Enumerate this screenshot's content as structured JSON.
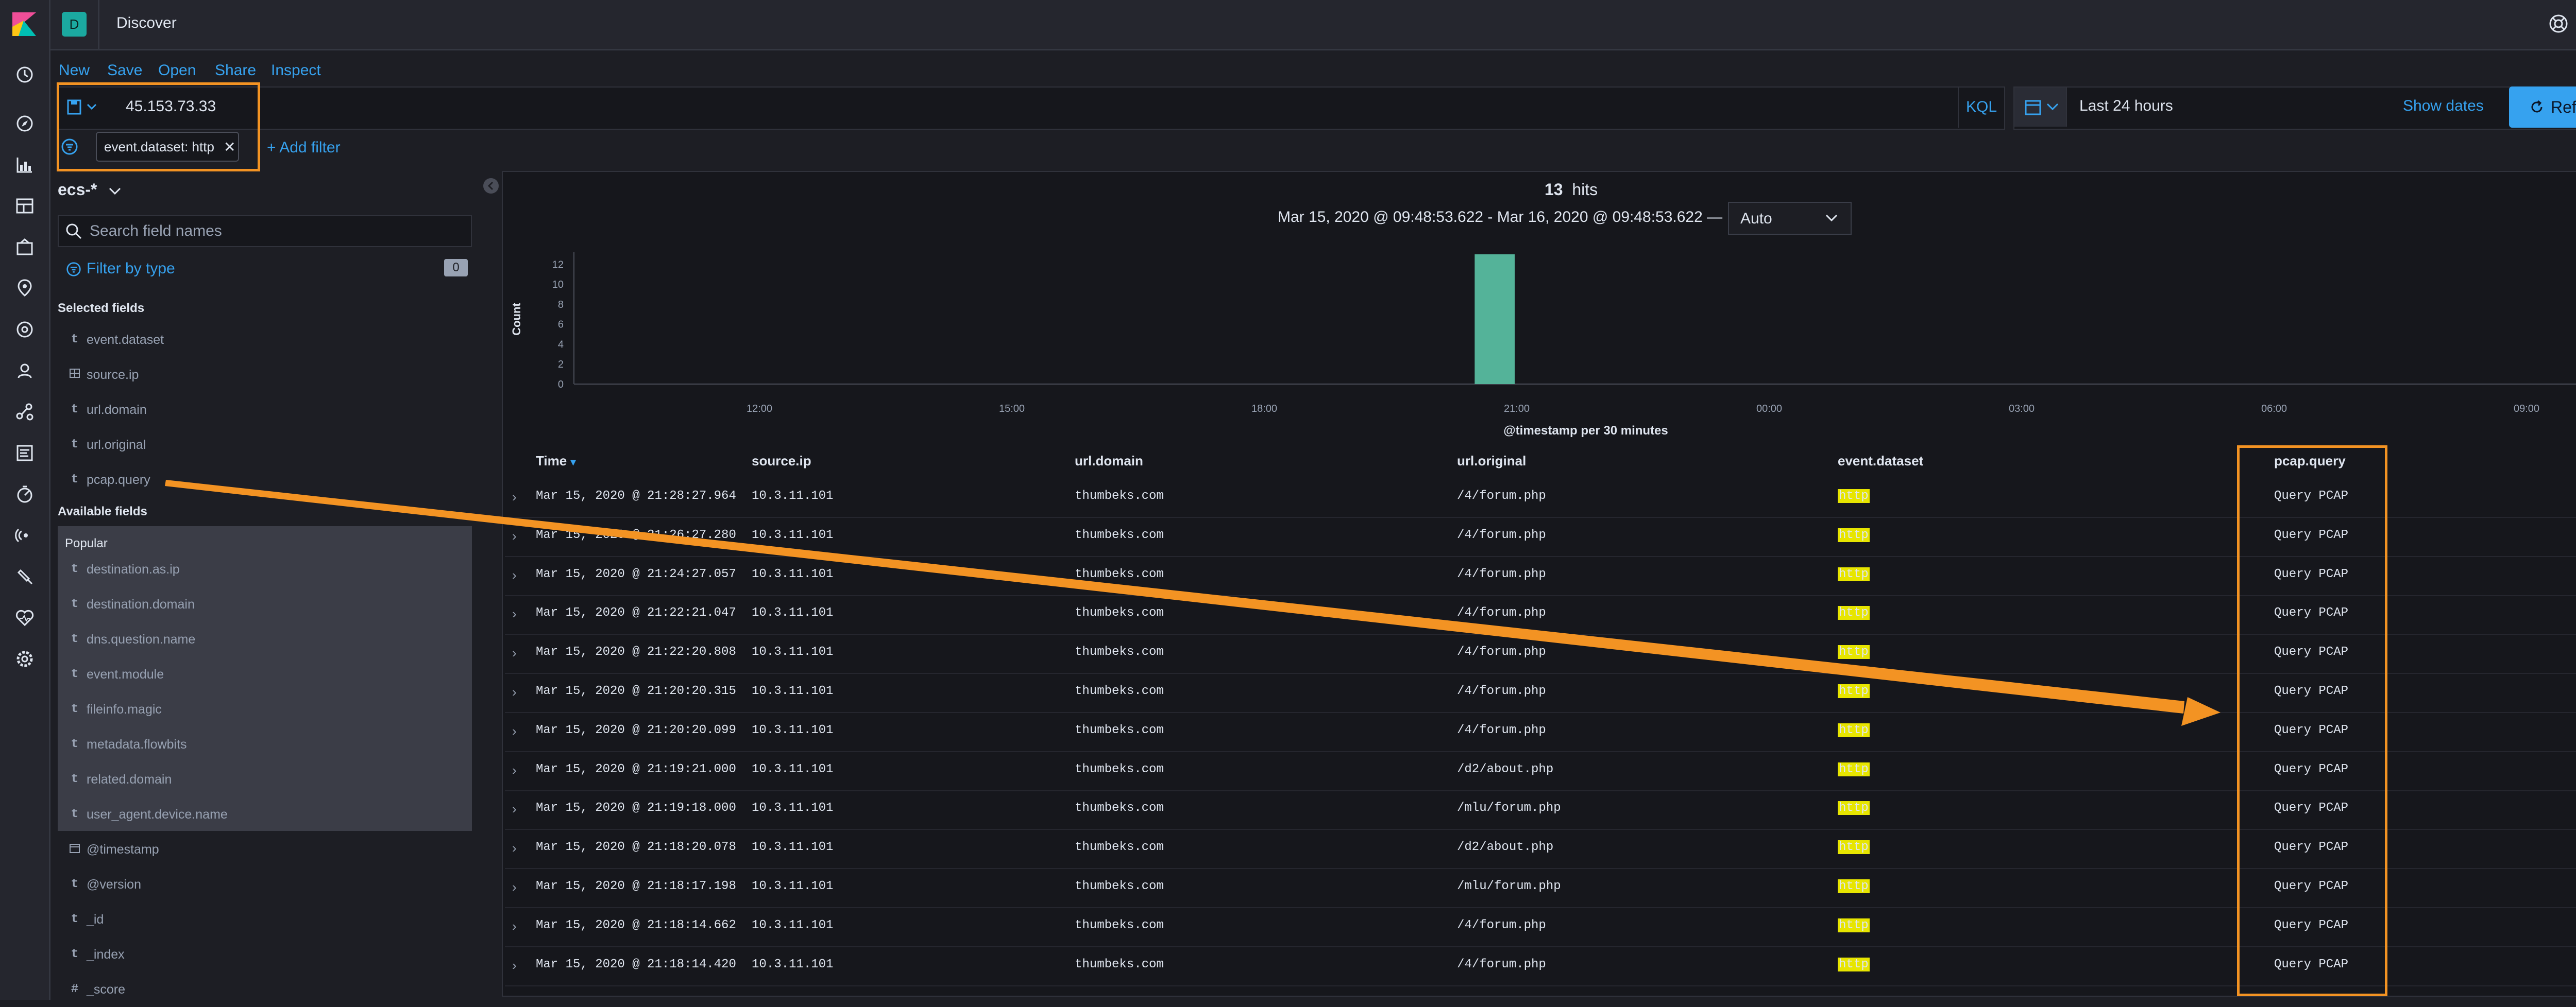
{
  "header": {
    "space_letter": "D",
    "app_title": "Discover"
  },
  "topmenu": [
    "New",
    "Save",
    "Open",
    "Share",
    "Inspect"
  ],
  "search": {
    "query": "45.153.73.33",
    "language": "KQL",
    "date_range": "Last 24 hours",
    "show_dates": "Show dates",
    "refresh": "Refresh"
  },
  "filters": {
    "pill": "event.dataset: http",
    "add_filter": "+ Add filter"
  },
  "sidebar": {
    "index_pattern": "ecs-*",
    "search_placeholder": "Search field names",
    "filter_by_type": "Filter by type",
    "filter_count": "0",
    "selected_title": "Selected fields",
    "selected": [
      {
        "type": "t",
        "name": "event.dataset"
      },
      {
        "type": "ip",
        "name": "source.ip"
      },
      {
        "type": "t",
        "name": "url.domain"
      },
      {
        "type": "t",
        "name": "url.original"
      },
      {
        "type": "t",
        "name": "pcap.query"
      }
    ],
    "available_title": "Available fields",
    "popular_title": "Popular",
    "popular": [
      {
        "type": "t",
        "name": "destination.as.ip"
      },
      {
        "type": "t",
        "name": "destination.domain"
      },
      {
        "type": "t",
        "name": "dns.question.name"
      },
      {
        "type": "t",
        "name": "event.module"
      },
      {
        "type": "t",
        "name": "fileinfo.magic"
      },
      {
        "type": "t",
        "name": "metadata.flowbits"
      },
      {
        "type": "t",
        "name": "related.domain"
      },
      {
        "type": "t",
        "name": "user_agent.device.name"
      }
    ],
    "other": [
      {
        "type": "date",
        "name": "@timestamp"
      },
      {
        "type": "t",
        "name": "@version"
      },
      {
        "type": "t",
        "name": "_id"
      },
      {
        "type": "t",
        "name": "_index"
      },
      {
        "type": "#",
        "name": "_score"
      }
    ]
  },
  "hits": {
    "count": "13",
    "label": "hits"
  },
  "date_range_text": "Mar 15, 2020 @ 09:48:53.622 - Mar 16, 2020 @ 09:48:53.622 —",
  "interval": "Auto",
  "chart_data": {
    "type": "bar",
    "ylabel": "Count",
    "xlabel": "@timestamp per 30 minutes",
    "yticks": [
      "0",
      "2",
      "4",
      "6",
      "8",
      "10",
      "12"
    ],
    "ylim": [
      0,
      13
    ],
    "xticks": [
      "12:00",
      "15:00",
      "18:00",
      "21:00",
      "00:00",
      "03:00",
      "06:00",
      "09:00"
    ],
    "bars": [
      {
        "x": "20:30",
        "value": 13
      }
    ],
    "bar_color": "#54b399",
    "marker_color": "#d0454e"
  },
  "table": {
    "headers": [
      "Time",
      "source.ip",
      "url.domain",
      "url.original",
      "event.dataset",
      "pcap.query"
    ],
    "rows": [
      {
        "time": "Mar 15, 2020 @ 21:28:27.964",
        "ip": "10.3.11.101",
        "domain": "thumbeks.com",
        "url": "/4/forum.php",
        "dataset": "http",
        "pcap": "Query PCAP"
      },
      {
        "time": "Mar 15, 2020 @ 21:26:27.280",
        "ip": "10.3.11.101",
        "domain": "thumbeks.com",
        "url": "/4/forum.php",
        "dataset": "http",
        "pcap": "Query PCAP"
      },
      {
        "time": "Mar 15, 2020 @ 21:24:27.057",
        "ip": "10.3.11.101",
        "domain": "thumbeks.com",
        "url": "/4/forum.php",
        "dataset": "http",
        "pcap": "Query PCAP"
      },
      {
        "time": "Mar 15, 2020 @ 21:22:21.047",
        "ip": "10.3.11.101",
        "domain": "thumbeks.com",
        "url": "/4/forum.php",
        "dataset": "http",
        "pcap": "Query PCAP"
      },
      {
        "time": "Mar 15, 2020 @ 21:22:20.808",
        "ip": "10.3.11.101",
        "domain": "thumbeks.com",
        "url": "/4/forum.php",
        "dataset": "http",
        "pcap": "Query PCAP"
      },
      {
        "time": "Mar 15, 2020 @ 21:20:20.315",
        "ip": "10.3.11.101",
        "domain": "thumbeks.com",
        "url": "/4/forum.php",
        "dataset": "http",
        "pcap": "Query PCAP"
      },
      {
        "time": "Mar 15, 2020 @ 21:20:20.099",
        "ip": "10.3.11.101",
        "domain": "thumbeks.com",
        "url": "/4/forum.php",
        "dataset": "http",
        "pcap": "Query PCAP"
      },
      {
        "time": "Mar 15, 2020 @ 21:19:21.000",
        "ip": "10.3.11.101",
        "domain": "thumbeks.com",
        "url": "/d2/about.php",
        "dataset": "http",
        "pcap": "Query PCAP"
      },
      {
        "time": "Mar 15, 2020 @ 21:19:18.000",
        "ip": "10.3.11.101",
        "domain": "thumbeks.com",
        "url": "/mlu/forum.php",
        "dataset": "http",
        "pcap": "Query PCAP"
      },
      {
        "time": "Mar 15, 2020 @ 21:18:20.078",
        "ip": "10.3.11.101",
        "domain": "thumbeks.com",
        "url": "/d2/about.php",
        "dataset": "http",
        "pcap": "Query PCAP"
      },
      {
        "time": "Mar 15, 2020 @ 21:18:17.198",
        "ip": "10.3.11.101",
        "domain": "thumbeks.com",
        "url": "/mlu/forum.php",
        "dataset": "http",
        "pcap": "Query PCAP"
      },
      {
        "time": "Mar 15, 2020 @ 21:18:14.662",
        "ip": "10.3.11.101",
        "domain": "thumbeks.com",
        "url": "/4/forum.php",
        "dataset": "http",
        "pcap": "Query PCAP"
      },
      {
        "time": "Mar 15, 2020 @ 21:18:14.420",
        "ip": "10.3.11.101",
        "domain": "thumbeks.com",
        "url": "/4/forum.php",
        "dataset": "http",
        "pcap": "Query PCAP"
      }
    ]
  },
  "colors": {
    "accent": "#36a2ef",
    "annotation": "#f39323",
    "highlight": "#e7e500"
  }
}
